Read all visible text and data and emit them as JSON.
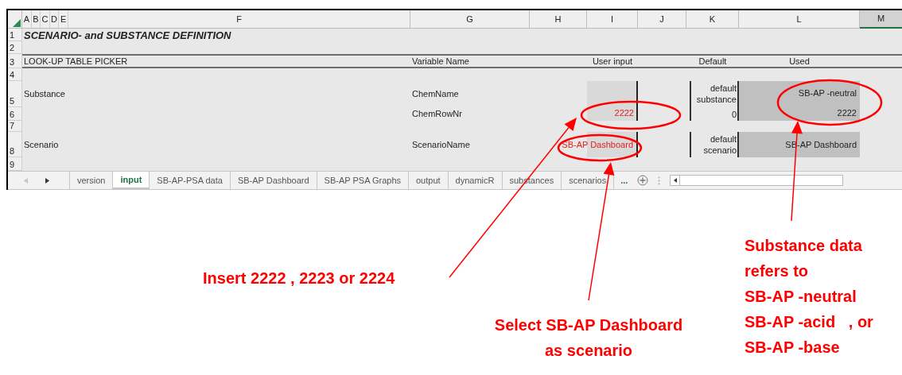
{
  "sheet": {
    "column_headers": [
      {
        "label": "A",
        "selected": false
      },
      {
        "label": "B",
        "selected": false
      },
      {
        "label": "C",
        "selected": false
      },
      {
        "label": "D",
        "selected": false
      },
      {
        "label": "E",
        "selected": false
      },
      {
        "label": "F",
        "selected": false
      },
      {
        "label": "G",
        "selected": false
      },
      {
        "label": "H",
        "selected": false
      },
      {
        "label": "I",
        "selected": false
      },
      {
        "label": "J",
        "selected": false
      },
      {
        "label": "K",
        "selected": false
      },
      {
        "label": "L",
        "selected": false
      },
      {
        "label": "M",
        "selected": true
      }
    ],
    "row_numbers": [
      "1",
      "2",
      "3",
      "4",
      "5",
      "6",
      "7",
      "8",
      "9"
    ],
    "title": "SCENARIO- and SUBSTANCE DEFINITION",
    "header": {
      "section": "LOOK-UP TABLE PICKER",
      "variable": "Variable Name",
      "user_input": "User input",
      "default": "Default",
      "used": "Used"
    },
    "substance": {
      "label": "Substance",
      "variables": [
        "ChemName",
        "ChemRowNr"
      ],
      "user_input": "2222",
      "default_label": "default substance",
      "default_value": "0",
      "used": [
        "SB-AP -neutral",
        "2222"
      ]
    },
    "scenario": {
      "label": "Scenario",
      "variable": "ScenarioName",
      "user_input": "SB-AP Dashboard",
      "default_label": "default scenario",
      "used": "SB-AP Dashboard"
    }
  },
  "sheet_tabs": [
    {
      "label": "version",
      "selected": false
    },
    {
      "label": "input",
      "selected": true
    },
    {
      "label": "SB-AP-PSA data",
      "selected": false
    },
    {
      "label": "SB-AP Dashboard",
      "selected": false
    },
    {
      "label": "SB-AP PSA Graphs",
      "selected": false
    },
    {
      "label": "output",
      "selected": false
    },
    {
      "label": "dynamicR",
      "selected": false
    },
    {
      "label": "substances",
      "selected": false
    },
    {
      "label": "scenarios",
      "selected": false
    }
  ],
  "more_tabs": "...",
  "annotations": [
    {
      "text": "Insert 2222 , 2223 or 2224"
    },
    {
      "text": "Select SB-AP Dashboard\nas scenario"
    },
    {
      "text": "Substance data\nrefers to\nSB-AP -neutral\nSB-AP -acid   , or\nSB-AP -base"
    }
  ]
}
